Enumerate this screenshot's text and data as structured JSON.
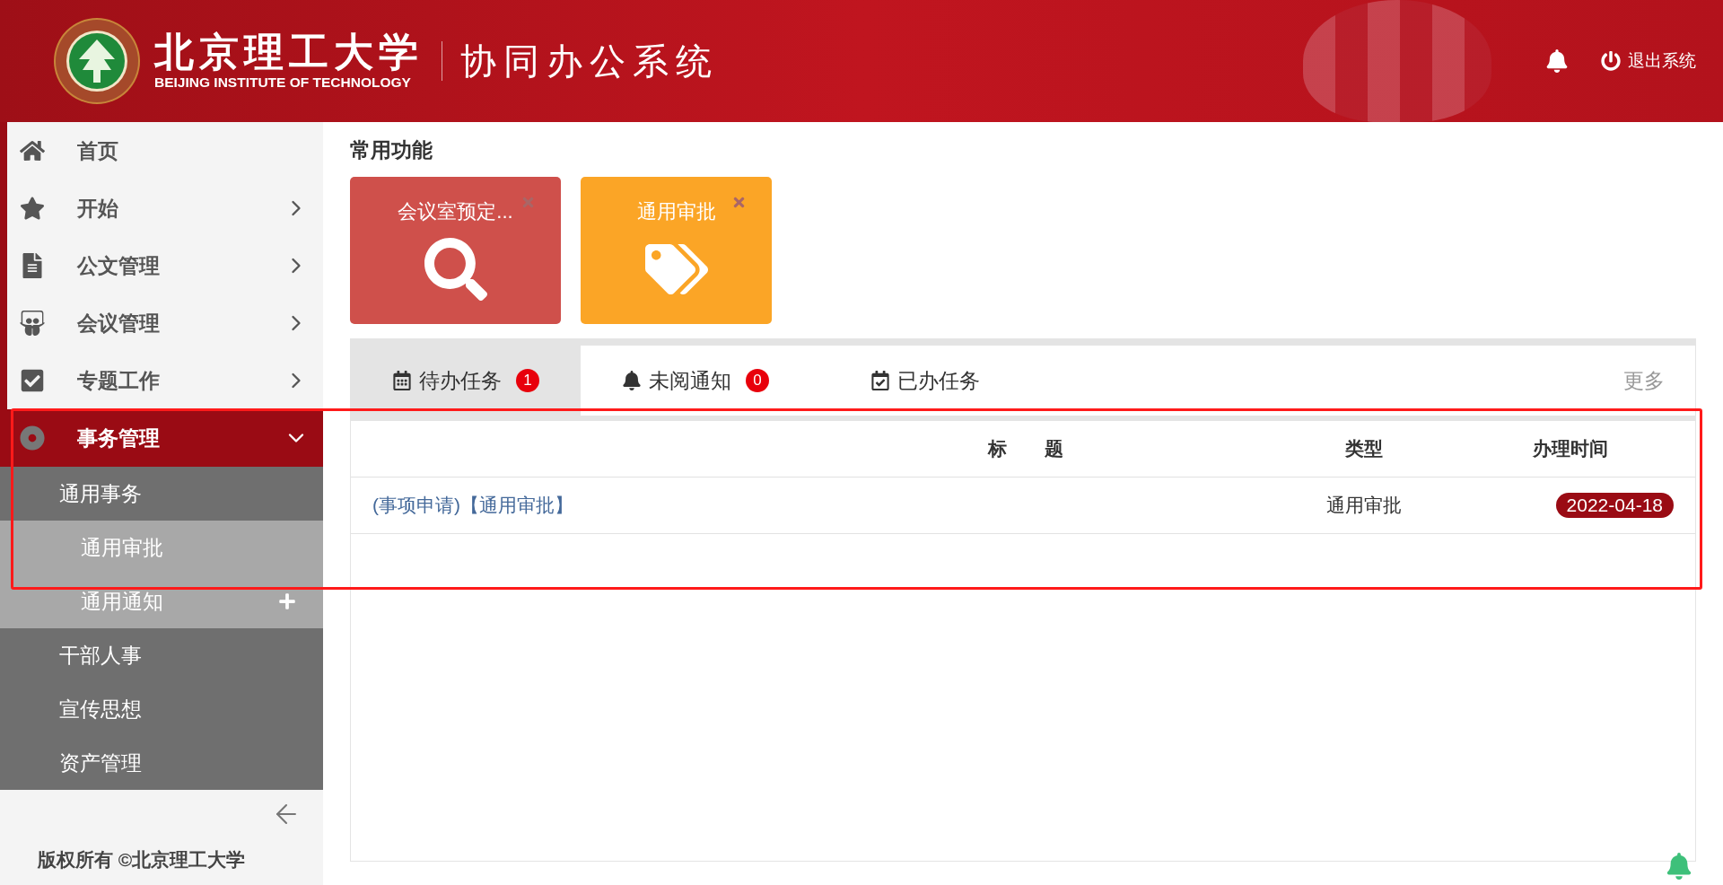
{
  "header": {
    "school_name": "北京理工大学",
    "school_name_en": "BEIJING INSTITUTE OF TECHNOLOGY",
    "system_name": "协同办公系统",
    "logout": "退出系统"
  },
  "sidebar": {
    "items": [
      {
        "label": "首页",
        "selected": false
      },
      {
        "label": "开始",
        "selected": false,
        "expanded": false
      },
      {
        "label": "公文管理",
        "selected": false,
        "expanded": false
      },
      {
        "label": "会议管理",
        "selected": false,
        "expanded": false
      },
      {
        "label": "专题工作",
        "selected": false,
        "expanded": false
      },
      {
        "label": "事务管理",
        "selected": true,
        "expanded": true,
        "children": [
          {
            "label": "通用事务",
            "expanded": true,
            "children": [
              {
                "label": "通用审批"
              },
              {
                "label": "通用通知",
                "expanded": false
              }
            ]
          },
          {
            "label": "干部人事"
          },
          {
            "label": "宣传思想"
          },
          {
            "label": "资产管理"
          }
        ]
      }
    ],
    "copyright": "版权所有 ©北京理工大学"
  },
  "shortcuts": {
    "title": "常用功能",
    "items": [
      {
        "label": "会议室预定...",
        "color": "#cf504b"
      },
      {
        "label": "通用审批",
        "color": "#fba526"
      }
    ]
  },
  "tasks": {
    "tabs": [
      {
        "label": "待办任务",
        "badge": "1",
        "selected": true
      },
      {
        "label": "未阅通知",
        "badge": "0",
        "selected": false
      },
      {
        "label": "已办任务",
        "selected": false
      }
    ],
    "more": "更多",
    "columns": [
      "标　　题",
      "类型",
      "办理时间"
    ],
    "rows": [
      {
        "title": "(事项申请)【通用审批】",
        "type": "通用审批",
        "time": "2022-04-18"
      }
    ]
  }
}
